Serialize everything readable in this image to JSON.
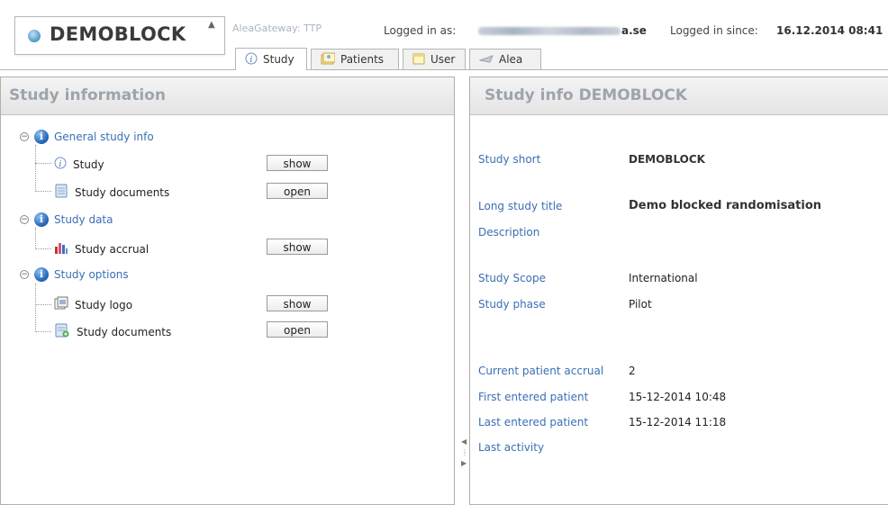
{
  "header": {
    "app_name": "DEMOBLOCK",
    "gateway": "AleaGateway: TTP",
    "logged_in_as_label": "Logged in as:",
    "email_suffix": "a.se",
    "logged_in_since_label": "Logged in since:",
    "logged_in_since_value": "16.12.2014 08:41"
  },
  "tabs": [
    {
      "label": "Study",
      "icon": "info-icon",
      "active": true
    },
    {
      "label": "Patients",
      "icon": "patients-icon",
      "active": false
    },
    {
      "label": "User",
      "icon": "user-icon",
      "active": false
    },
    {
      "label": "Alea",
      "icon": "alea-icon",
      "active": false
    }
  ],
  "left_panel": {
    "title": "Study information",
    "groups": [
      {
        "label": "General study info",
        "items": [
          {
            "label": "Study",
            "icon": "info-icon",
            "action": "show"
          },
          {
            "label": "Study documents",
            "icon": "document-icon",
            "action": "open"
          }
        ]
      },
      {
        "label": "Study data",
        "items": [
          {
            "label": "Study accrual",
            "icon": "bar-chart-icon",
            "action": "show"
          }
        ]
      },
      {
        "label": "Study options",
        "items": [
          {
            "label": "Study logo",
            "icon": "logo-icon",
            "action": "show"
          },
          {
            "label": "Study documents",
            "icon": "document-add-icon",
            "action": "open"
          }
        ]
      }
    ]
  },
  "right_panel": {
    "title": "Study info DEMOBLOCK",
    "fields": {
      "study_short": {
        "label": "Study short",
        "value": "DEMOBLOCK"
      },
      "long_title": {
        "label": "Long study title",
        "value": "Demo blocked randomisation"
      },
      "description": {
        "label": "Description",
        "value": ""
      },
      "scope": {
        "label": "Study Scope",
        "value": "International"
      },
      "phase": {
        "label": "Study phase",
        "value": "Pilot"
      },
      "accrual": {
        "label": "Current patient accrual",
        "value": "2"
      },
      "first_patient": {
        "label": "First entered patient",
        "value": "15-12-2014 10:48"
      },
      "last_patient": {
        "label": "Last entered patient",
        "value": "15-12-2014 11:18"
      },
      "last_activity": {
        "label": "Last activity",
        "value": ""
      }
    }
  },
  "colors": {
    "link_blue": "#3a70b5",
    "panel_title_gray": "#9da4ad"
  }
}
